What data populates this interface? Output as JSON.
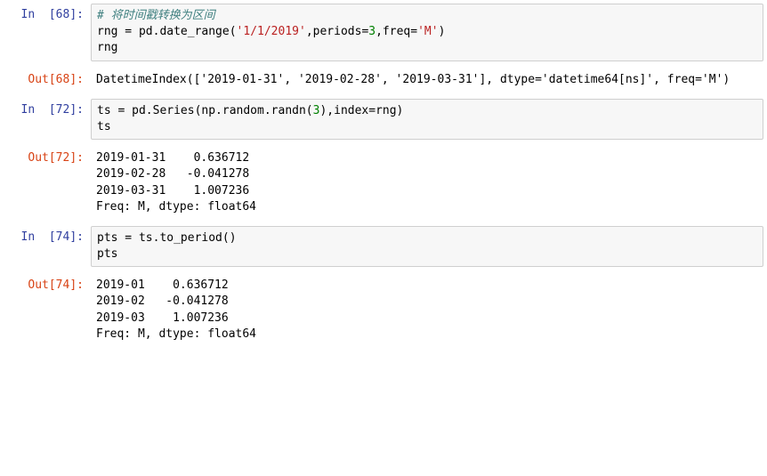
{
  "cells": [
    {
      "prompt_in": "In  [68]:",
      "code": {
        "comment": "# 将时间戳转换为区间",
        "line2_pre": "rng = pd.date_range(",
        "line2_str1": "'1/1/2019'",
        "line2_mid": ",periods=",
        "line2_num": "3",
        "line2_mid2": ",freq=",
        "line2_str2": "'M'",
        "line2_end": ")",
        "line3": "rng"
      },
      "prompt_out": "Out[68]:",
      "output": "DatetimeIndex(['2019-01-31', '2019-02-28', '2019-03-31'], dtype='datetime64[ns]', freq='M')"
    },
    {
      "prompt_in": "In  [72]:",
      "code": {
        "line1_pre": "ts = pd.Series(np.random.randn(",
        "line1_num": "3",
        "line1_end": "),index=rng)",
        "line2": "ts"
      },
      "prompt_out": "Out[72]:",
      "output": "2019-01-31    0.636712\n2019-02-28   -0.041278\n2019-03-31    1.007236\nFreq: M, dtype: float64"
    },
    {
      "prompt_in": "In  [74]:",
      "code": {
        "line1": "pts = ts.to_period()",
        "line2": "pts"
      },
      "prompt_out": "Out[74]:",
      "output": "2019-01    0.636712\n2019-02   -0.041278\n2019-03    1.007236\nFreq: M, dtype: float64"
    }
  ]
}
